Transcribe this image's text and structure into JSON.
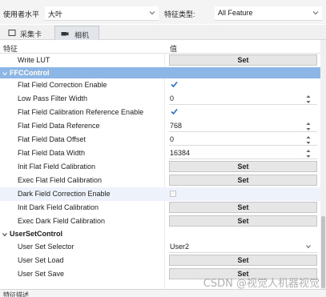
{
  "filter": {
    "usage_label": "使用者水平",
    "usage_value": "大叶",
    "feature_type_label": "特征类型:",
    "feature_type_value": "All Feature"
  },
  "tabs": [
    {
      "label": "采集卡",
      "icon": "capture-card-icon",
      "active": false
    },
    {
      "label": "相机",
      "icon": "camera-icon",
      "active": true
    }
  ],
  "table": {
    "col_feature": "特征",
    "col_value": "值"
  },
  "rows": [
    {
      "label": "Write LUT",
      "kind": "button",
      "value": "Set"
    },
    {
      "label": "FFCControl",
      "kind": "category",
      "selected": true
    },
    {
      "label": "Flat Field Correction Enable",
      "kind": "checkbox",
      "checked": true
    },
    {
      "label": "Low Pass Filter Width",
      "kind": "spin",
      "value": "0"
    },
    {
      "label": "Flat Field Calibration Reference Enable",
      "kind": "checkbox",
      "checked": true
    },
    {
      "label": "Flat Field Data Reference",
      "kind": "spin",
      "value": "768"
    },
    {
      "label": "Flat Field Data Offset",
      "kind": "spin",
      "value": "0"
    },
    {
      "label": "Flat Field Data Width",
      "kind": "spin",
      "value": "16384"
    },
    {
      "label": "Init Flat Field Calibration",
      "kind": "button",
      "value": "Set"
    },
    {
      "label": "Exec Flat Field Calibration",
      "kind": "button",
      "value": "Set"
    },
    {
      "label": "Dark Field Correction Enable",
      "kind": "checkbox",
      "checked": false
    },
    {
      "label": "Init Dark Field Calibration",
      "kind": "button",
      "value": "Set"
    },
    {
      "label": "Exec Dark Field Calibration",
      "kind": "button",
      "value": "Set"
    },
    {
      "label": "UserSetControl",
      "kind": "category",
      "selected": false
    },
    {
      "label": "User Set Selector",
      "kind": "select",
      "value": "User2"
    },
    {
      "label": "User Set Load",
      "kind": "button",
      "value": "Set"
    },
    {
      "label": "User Set Save",
      "kind": "button",
      "value": "Set"
    }
  ],
  "bottom_label": "特征描述",
  "watermark": "CSDN @视觉人机器视觉",
  "colors": {
    "selected_category": "#8cb6e6",
    "checkmark": "#2a6fd6"
  }
}
